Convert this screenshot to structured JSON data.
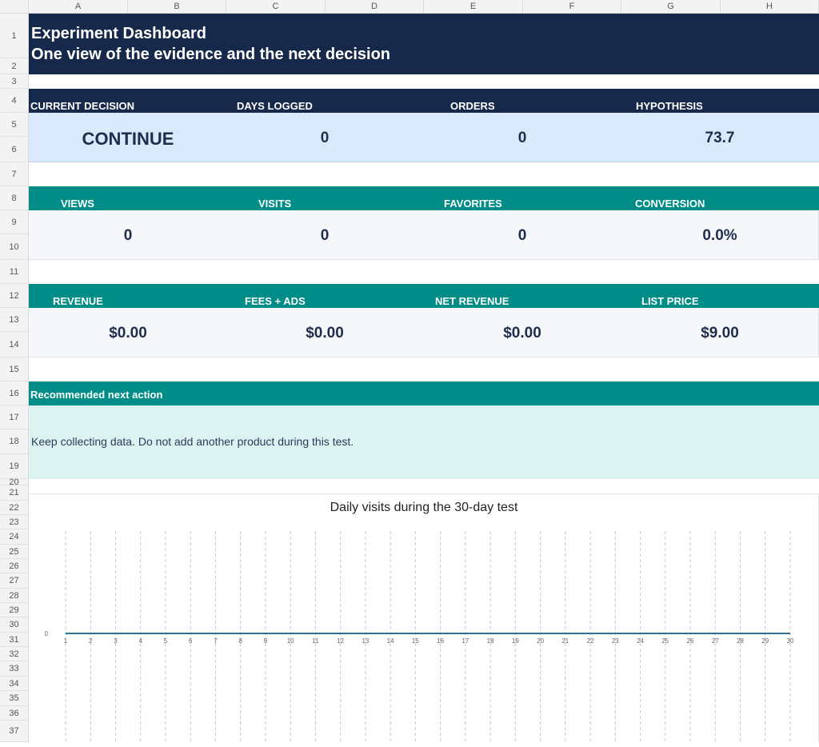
{
  "columns": [
    "A",
    "B",
    "C",
    "D",
    "E",
    "F",
    "G",
    "H"
  ],
  "rows": [
    "1",
    "2",
    "3",
    "4",
    "5",
    "6",
    "7",
    "8",
    "9",
    "10",
    "11",
    "12",
    "13",
    "14",
    "15",
    "16",
    "17",
    "18",
    "19",
    "20",
    "21",
    "22",
    "23",
    "24",
    "25",
    "26",
    "27",
    "28",
    "29",
    "30",
    "31",
    "32",
    "33",
    "34",
    "35",
    "36",
    "37"
  ],
  "header": {
    "title": "Experiment Dashboard",
    "subtitle": "One view of the evidence and the next decision"
  },
  "summary": {
    "labels": [
      "CURRENT DECISION",
      "DAYS LOGGED",
      "ORDERS",
      "HYPOTHESIS"
    ],
    "values": [
      "CONTINUE",
      "0",
      "0",
      "73.7"
    ]
  },
  "traffic": {
    "labels": [
      "VIEWS",
      "VISITS",
      "FAVORITES",
      "CONVERSION"
    ],
    "values": [
      "0",
      "0",
      "0",
      "0.0%"
    ]
  },
  "money": {
    "labels": [
      "REVENUE",
      "FEES + ADS",
      "NET REVENUE",
      "LIST PRICE"
    ],
    "values": [
      "$0.00",
      "$0.00",
      "$0.00",
      "$9.00"
    ]
  },
  "action": {
    "heading": "Recommended next action",
    "text": "Keep collecting data. Do not add another product during this test."
  },
  "colors": {
    "navy": "#17294a",
    "teal": "#008c87",
    "light_blue": "#dbe9fd",
    "light_teal": "#ddf3f1",
    "line": "#2f6f8f"
  },
  "chart_data": {
    "type": "line",
    "title": "Daily visits during the 30-day test",
    "x": [
      1,
      2,
      3,
      4,
      5,
      6,
      7,
      8,
      9,
      10,
      11,
      12,
      13,
      14,
      15,
      16,
      17,
      18,
      19,
      20,
      21,
      22,
      23,
      24,
      25,
      26,
      27,
      28,
      29,
      30
    ],
    "series": [
      {
        "values": [
          0,
          0,
          0,
          0,
          0,
          0,
          0,
          0,
          0,
          0,
          0,
          0,
          0,
          0,
          0,
          0,
          0,
          0,
          0,
          0,
          0,
          0,
          0,
          0,
          0,
          0,
          0,
          0,
          0,
          0
        ]
      }
    ],
    "y_ticks": [
      "0"
    ],
    "xlabel": "",
    "ylabel": "",
    "grid": "vertical dashed"
  }
}
